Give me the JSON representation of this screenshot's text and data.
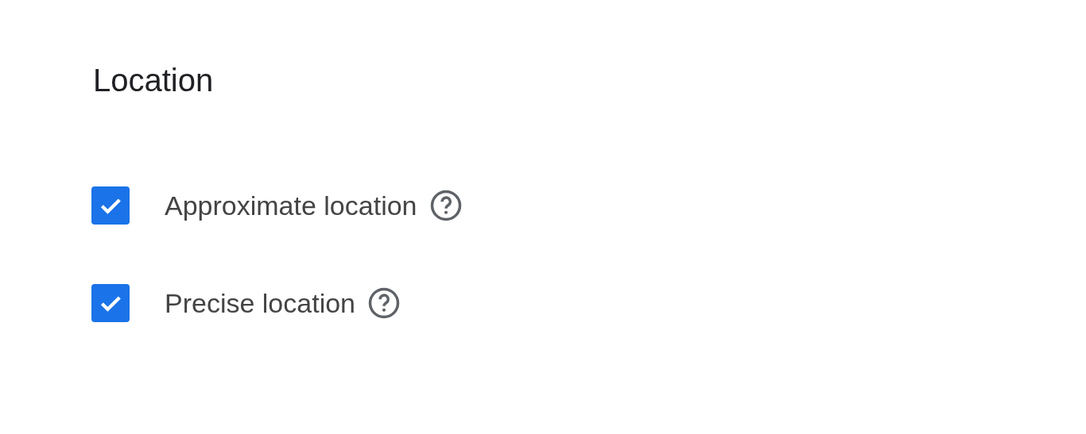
{
  "title": "Location",
  "options": [
    {
      "label": "Approximate location",
      "checked": true
    },
    {
      "label": "Precise location",
      "checked": true
    }
  ]
}
